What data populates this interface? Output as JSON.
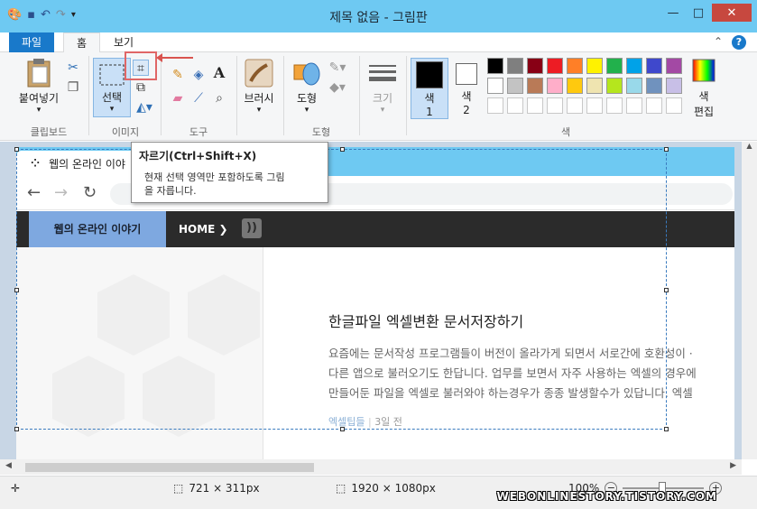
{
  "window": {
    "title": "제목 없음 - 그림판"
  },
  "tabs": [
    {
      "label": "파일"
    },
    {
      "label": "홈"
    },
    {
      "label": "보기"
    }
  ],
  "ribbon": {
    "clipboard": {
      "paste_label": "붙여넣기",
      "group_label": "클립보드"
    },
    "image": {
      "select_label": "선택",
      "group_label": "이미지"
    },
    "tools": {
      "group_label": "도구"
    },
    "brushes": {
      "label": "브러시"
    },
    "shapes": {
      "shapes_label": "도형",
      "group_label": "도형"
    },
    "size": {
      "label": "크기"
    },
    "colors": {
      "color1_label": "색",
      "color1_num": "1",
      "color2_label": "색",
      "color2_num": "2",
      "edit_label": "색",
      "edit_label2": "편집",
      "group_label": "색",
      "row1": [
        "#000000",
        "#7f7f7f",
        "#880015",
        "#ed1c24",
        "#ff7f27",
        "#fff200",
        "#22b14c",
        "#00a2e8",
        "#3f48cc",
        "#a349a4"
      ],
      "row2": [
        "#ffffff",
        "#c3c3c3",
        "#b97a57",
        "#ffaec9",
        "#ffc90e",
        "#efe4b0",
        "#b5e61d",
        "#99d9ea",
        "#7092be",
        "#c8bfe7"
      ]
    }
  },
  "tooltip": {
    "title": "자르기(Ctrl+Shift+X)",
    "text1": "현재 선택 영역만 포함하도록 그림",
    "text2": "을 자릅니다."
  },
  "browser": {
    "tab_title": "웹의 온라인 이야",
    "nav_brand": "웹의 온라인 이야기",
    "nav_home": "HOME ❯"
  },
  "post": {
    "title": "한글파일 엑셀변환 문서저장하기",
    "line1": "요즘에는 문서작성 프로그램들이 버전이 올라가게 되면서 서로간에 호환성이 ·",
    "line2": "다른 앱으로 불러오기도 한답니다. 업무를 보면서 자주 사용하는 엑셀의 경우에",
    "line3": "만들어둔 파일을 엑셀로 불러와야 하는경우가 종종 발생할수가 있답니다. 엑셀",
    "category": "엑셀팁들",
    "time": "3일 전"
  },
  "status": {
    "selection_size": "721 × 311px",
    "image_size": "1920 × 1080px",
    "zoom": "100%"
  },
  "watermark": "WEBONLINESTORY.TISTORY.COM"
}
